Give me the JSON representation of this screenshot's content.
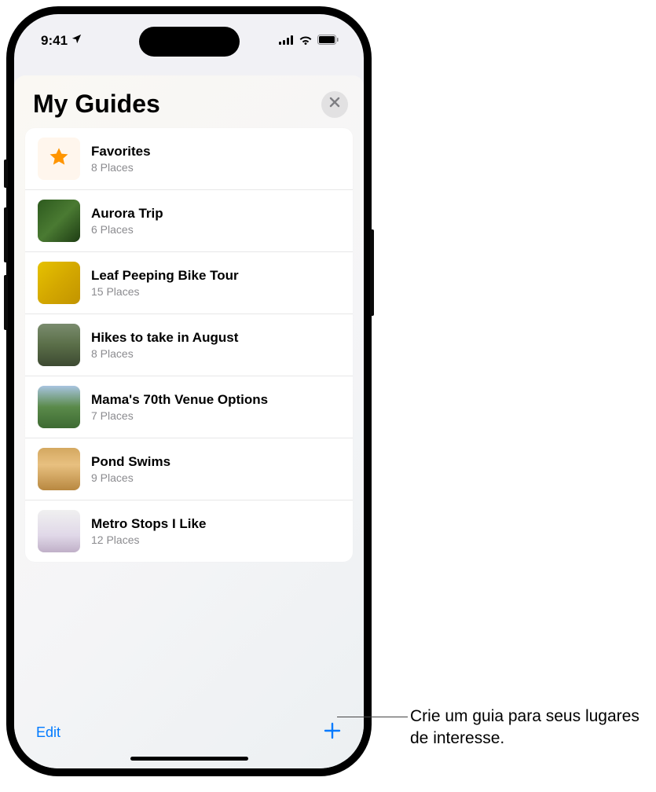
{
  "statusBar": {
    "time": "9:41"
  },
  "sheet": {
    "title": "My Guides"
  },
  "guides": [
    {
      "title": "Favorites",
      "subtitle": "8 Places"
    },
    {
      "title": "Aurora Trip",
      "subtitle": "6 Places"
    },
    {
      "title": "Leaf Peeping Bike Tour",
      "subtitle": "15 Places"
    },
    {
      "title": "Hikes to take in August",
      "subtitle": "8 Places"
    },
    {
      "title": "Mama's 70th Venue Options",
      "subtitle": "7 Places"
    },
    {
      "title": "Pond Swims",
      "subtitle": "9 Places"
    },
    {
      "title": "Metro Stops I Like",
      "subtitle": "12 Places"
    }
  ],
  "bottomBar": {
    "editLabel": "Edit"
  },
  "callout": {
    "text": "Crie um guia para seus lugares de interesse."
  }
}
